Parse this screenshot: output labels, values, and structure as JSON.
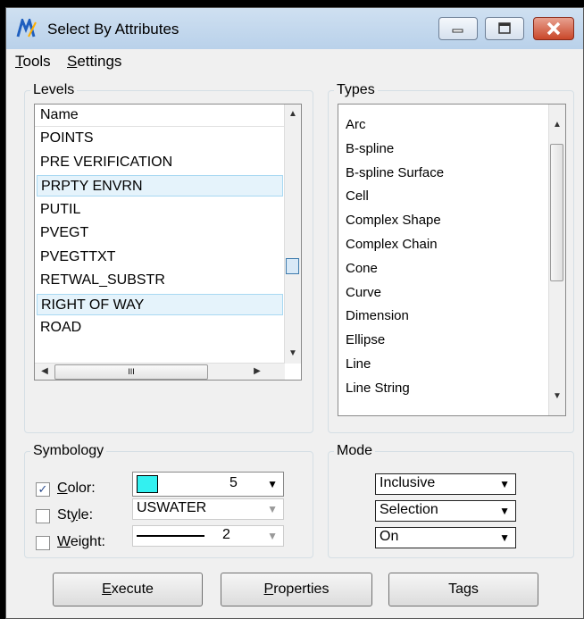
{
  "window": {
    "title": "Select By Attributes"
  },
  "menu": [
    {
      "accel": "T",
      "rest": "ools"
    },
    {
      "accel": "S",
      "rest": "ettings"
    }
  ],
  "levels": {
    "group_label": "Levels",
    "column_header": "Name",
    "items": [
      {
        "label": "POINTS",
        "selected": false
      },
      {
        "label": "PRE VERIFICATION",
        "selected": false
      },
      {
        "label": "PRPTY ENVRN",
        "selected": true
      },
      {
        "label": "PUTIL",
        "selected": false
      },
      {
        "label": "PVEGT",
        "selected": false
      },
      {
        "label": "PVEGTTXT",
        "selected": false
      },
      {
        "label": "RETWAL_SUBSTR",
        "selected": false
      },
      {
        "label": "RIGHT OF WAY",
        "selected": true
      },
      {
        "label": "ROAD",
        "selected": false
      }
    ],
    "hscroll_thumb_glyph": "III"
  },
  "types": {
    "group_label": "Types",
    "items": [
      "Arc",
      "B-spline",
      "B-spline Surface",
      "Cell",
      "Complex Shape",
      "Complex Chain",
      "Cone",
      "Curve",
      "Dimension",
      "Ellipse",
      "Line",
      "Line String"
    ]
  },
  "symbology": {
    "group_label": "Symbology",
    "color": {
      "accel": "C",
      "rest": "olor:",
      "checked": true,
      "value": "5",
      "swatch": "#33f0f0"
    },
    "style": {
      "pre": "St",
      "accel": "y",
      "rest": "le:",
      "checked": false,
      "value": "USWATER"
    },
    "weight": {
      "accel": "W",
      "rest": "eight:",
      "checked": false,
      "value": "2"
    }
  },
  "mode": {
    "group_label": "Mode",
    "selects": [
      "Inclusive",
      "Selection",
      "On"
    ]
  },
  "buttons": [
    {
      "accel": "E",
      "rest": "xecute"
    },
    {
      "accel": "P",
      "rest": "roperties"
    },
    {
      "pre": "Ta",
      "accel": "g",
      "rest": "s"
    }
  ],
  "colors": {
    "selection_bg": "#e5f3fb",
    "selection_border": "#a8d8f2"
  }
}
